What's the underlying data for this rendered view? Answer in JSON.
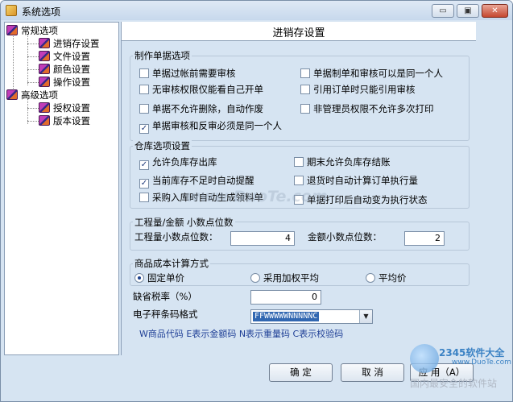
{
  "window": {
    "title": "系统选项",
    "min_glyph": "▭",
    "max_glyph": "▣",
    "close_glyph": "✕"
  },
  "tree": {
    "groups": [
      {
        "label": "常规选项",
        "children": [
          "进销存设置",
          "文件设置",
          "颜色设置",
          "操作设置"
        ]
      },
      {
        "label": "高级选项",
        "children": [
          "授权设置",
          "版本设置"
        ]
      }
    ]
  },
  "header": {
    "title": "进销存设置"
  },
  "voucher": {
    "title": "制作单据选项",
    "options": [
      {
        "label": "单据过帐前需要审核",
        "checked": false
      },
      {
        "label": "单据制单和审核可以是同一个人",
        "checked": false
      },
      {
        "label": "无审核权限仅能看自己开单",
        "checked": false
      },
      {
        "label": "引用订单时只能引用审核",
        "checked": false
      },
      {
        "label": "单据不允许删除，自动作废",
        "checked": false
      },
      {
        "label": "非管理员权限不允许多次打印",
        "checked": false
      },
      {
        "label": "单据审核和反审必须是同一个人",
        "checked": true
      }
    ]
  },
  "warehouse": {
    "title": "仓库选项设置",
    "options": [
      {
        "label": "允许负库存出库",
        "checked": true
      },
      {
        "label": "期末允许负库存结账",
        "checked": false
      },
      {
        "label": "当前库存不足时自动提醒",
        "checked": true
      },
      {
        "label": "退货时自动计算订单执行量",
        "checked": false
      },
      {
        "label": "采购入库时自动生成领料单",
        "checked": false
      },
      {
        "label": "单据打印后自动变为执行状态",
        "checked": false
      }
    ]
  },
  "decimals": {
    "title": "工程量/金额  小数点位数",
    "qty_label": "工程量小数点位数：",
    "qty_value": "4",
    "amount_label": "金额小数点位数：",
    "amount_value": "2"
  },
  "cost": {
    "title": "商品成本计算方式",
    "options": [
      {
        "label": "固定单价",
        "selected": true
      },
      {
        "label": "采用加权平均",
        "selected": false
      },
      {
        "label": "平均价",
        "selected": false
      }
    ]
  },
  "tax": {
    "label": "缺省税率（%）",
    "value": "0"
  },
  "barcode": {
    "label": "电子秤条码格式",
    "value": "FFWWWWWNNNNNC",
    "hint": "W商品代码 E表示金额码 N表示重量码 C表示校验码",
    "arrow_glyph": "▼"
  },
  "buttons": {
    "ok": "确   定",
    "cancel": "取   消",
    "apply": "应 用（A）"
  },
  "watermark": "www.DuoTe.com",
  "badge": {
    "brand": "2345软件大全",
    "url": "www.DuoTe.com",
    "slogan": "国内最安全的软件站"
  },
  "check_glyph": "✓"
}
